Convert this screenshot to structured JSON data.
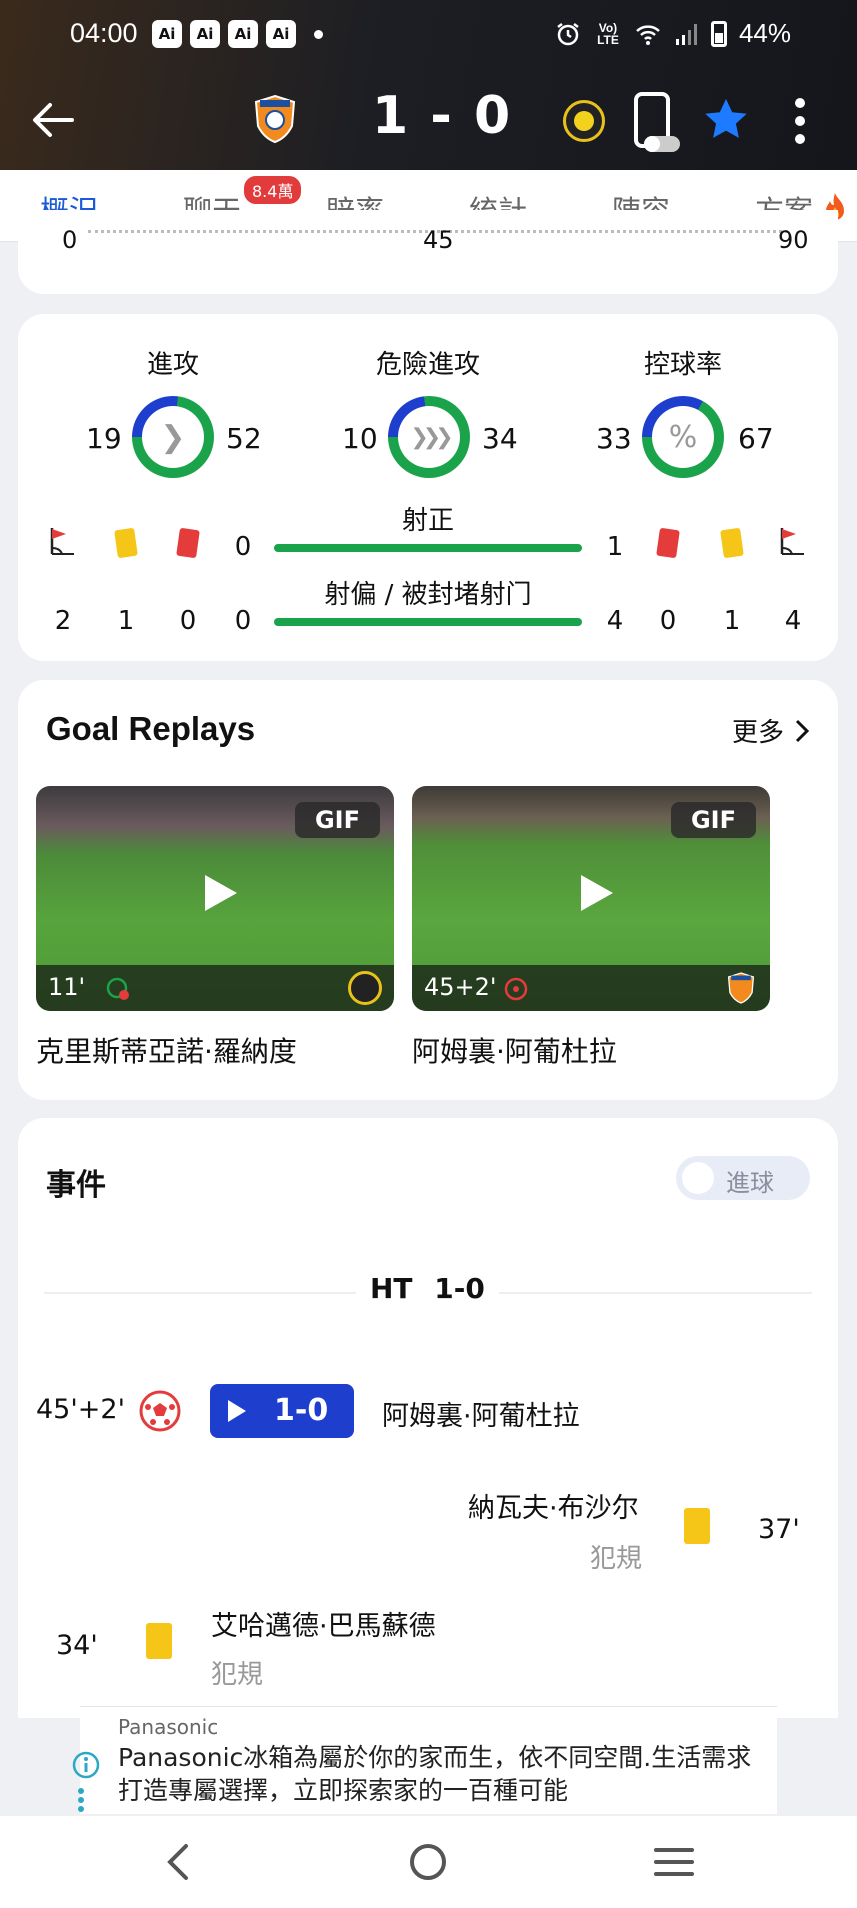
{
  "status_bar": {
    "time": "04:00",
    "ai_badges": [
      "Ai",
      "Ai",
      "Ai",
      "Ai"
    ],
    "lte_label": "Vo) LTE",
    "battery": "44%"
  },
  "match": {
    "score": "1 - 0"
  },
  "tabs": [
    {
      "label": "概況",
      "active": true
    },
    {
      "label": "聊天",
      "badge": "8.4萬"
    },
    {
      "label": "賠率"
    },
    {
      "label": "統計"
    },
    {
      "label": "陣容"
    },
    {
      "label": "方案"
    }
  ],
  "timeline": {
    "start": "0",
    "mid": "45",
    "end": "90"
  },
  "stats": {
    "attack": {
      "label": "進攻",
      "home": "19",
      "away": "52",
      "home_fraction": 0.27
    },
    "danger": {
      "label": "危險進攻",
      "home": "10",
      "away": "34",
      "home_fraction": 0.23
    },
    "possession": {
      "label": "控球率",
      "home": "33",
      "away": "67",
      "home_fraction": 0.33
    },
    "on_target": {
      "label": "射正",
      "home": "0",
      "away": "1"
    },
    "off_target": {
      "label": "射偏 / 被封堵射门",
      "home": "0",
      "away": "4"
    },
    "home_corners": "2",
    "home_yellow": "1",
    "home_red": "0",
    "away_red": "0",
    "away_yellow": "1",
    "away_corners": "4",
    "possession_symbol": "%"
  },
  "goal_replays": {
    "title": "Goal Replays",
    "more": "更多",
    "videos": [
      {
        "tag": "GIF",
        "minute": "11'",
        "caption": "克里斯蒂亞諾·羅納度"
      },
      {
        "tag": "GIF",
        "minute": "45+2'",
        "caption": "阿姆裏·阿葡杜拉"
      }
    ]
  },
  "events": {
    "title": "事件",
    "toggle_label": "進球",
    "ht_label": "HT",
    "ht_score": "1-0",
    "items": [
      {
        "minute": "45'+2'",
        "score": "1-0",
        "player": "阿姆裏·阿葡杜拉"
      },
      {
        "minute": "37'",
        "player": "納瓦夫·布沙尔",
        "detail": "犯規"
      },
      {
        "minute": "34'",
        "player": "艾哈邁德·巴馬蘇德",
        "detail": "犯規"
      }
    ]
  },
  "ad": {
    "brand": "Panasonic",
    "text": "Panasonic冰箱為屬於你的家而生，依不同空間.生活需求打造專屬選擇，立即探索家的一百種可能"
  },
  "colors": {
    "accent_blue": "#1a59d8",
    "green": "#1aa34a",
    "ring_blue": "#1e3fce",
    "yellow_card": "#f5c518",
    "red_card": "#e43b3b"
  }
}
